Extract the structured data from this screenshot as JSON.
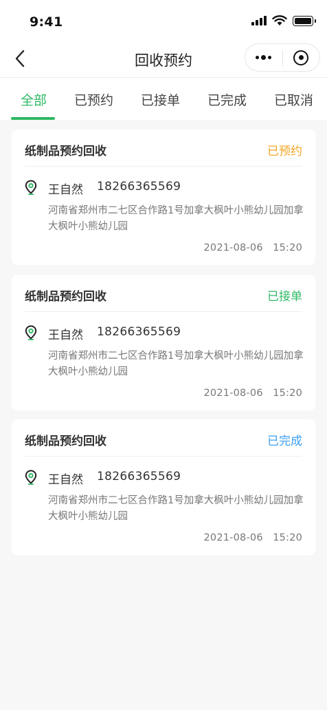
{
  "status_bar": {
    "time": "9:41"
  },
  "nav": {
    "title": "回收预约"
  },
  "tabs": [
    {
      "label": "全部"
    },
    {
      "label": "已预约"
    },
    {
      "label": "已接单"
    },
    {
      "label": "已完成"
    },
    {
      "label": "已取消"
    }
  ],
  "active_tab": "全部",
  "colors": {
    "accent": "#2db963",
    "status_booked": "#f5a623",
    "status_accepted": "#2db963",
    "status_completed": "#3b9ff0"
  },
  "orders": [
    {
      "title": "纸制品预约回收",
      "status": "已预约",
      "name": "王自然",
      "phone": "18266365569",
      "address": "河南省郑州市二七区合作路1号加拿大枫叶小熊幼儿园加拿大枫叶小熊幼儿园",
      "date": "2021-08-06",
      "time": "15:20"
    },
    {
      "title": "纸制品预约回收",
      "status": "已接单",
      "name": "王自然",
      "phone": "18266365569",
      "address": "河南省郑州市二七区合作路1号加拿大枫叶小熊幼儿园加拿大枫叶小熊幼儿园",
      "date": "2021-08-06",
      "time": "15:20"
    },
    {
      "title": "纸制品预约回收",
      "status": "已完成",
      "name": "王自然",
      "phone": "18266365569",
      "address": "河南省郑州市二七区合作路1号加拿大枫叶小熊幼儿园加拿大枫叶小熊幼儿园",
      "date": "2021-08-06",
      "time": "15:20"
    }
  ],
  "icons": {
    "back": "chevron-left-icon",
    "more": "more-dots-icon",
    "close_target": "target-circle-icon",
    "location": "location-pin-icon"
  }
}
